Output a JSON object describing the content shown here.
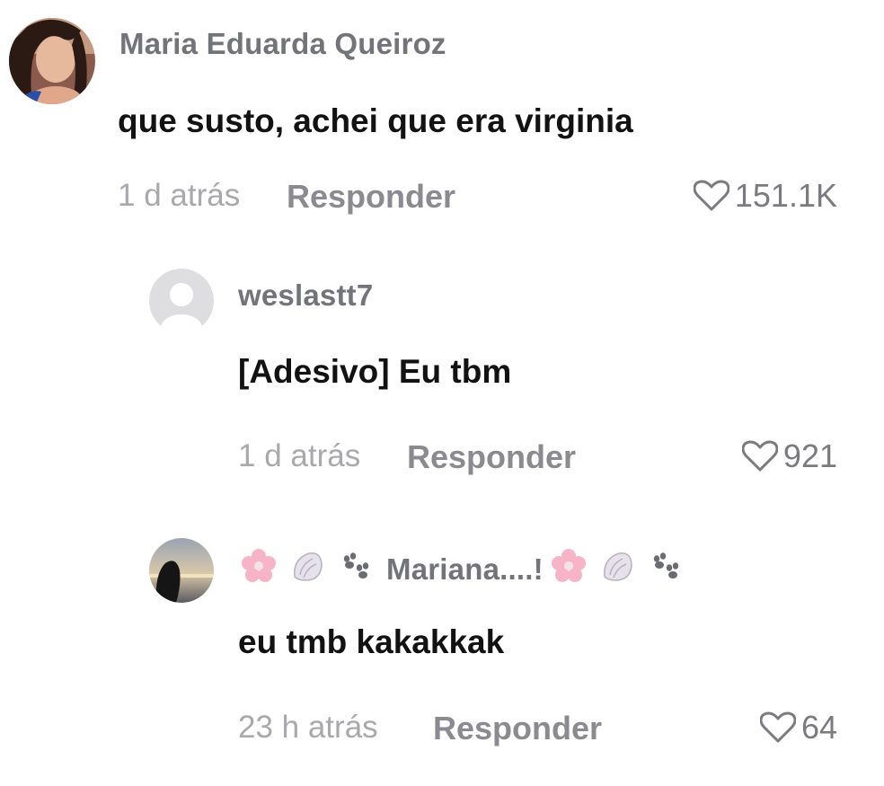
{
  "comments": [
    {
      "username": "Maria Eduarda Queiroz",
      "text": "que susto, achei que era virginia",
      "time": "1 d atrás",
      "reply_label": "Responder",
      "likes": "151.1K"
    },
    {
      "username": "weslastt7",
      "text": "[Adesivo] Eu tbm",
      "time": "1 d atrás",
      "reply_label": "Responder",
      "likes": "921"
    },
    {
      "username_prefix_icons": [
        "cherry-blossom-icon",
        "shell-icon",
        "paw-prints-icon"
      ],
      "username": "Mariana....!",
      "username_suffix_icons": [
        "cherry-blossom-icon",
        "shell-icon",
        "paw-prints-icon"
      ],
      "text": "eu tmb kakakkak",
      "time": "23 h atrás",
      "reply_label": "Responder",
      "likes": "64"
    }
  ],
  "colors": {
    "username": "#73737a",
    "text": "#121212",
    "meta": "#a8a8ad",
    "reply": "#8a8a90"
  }
}
